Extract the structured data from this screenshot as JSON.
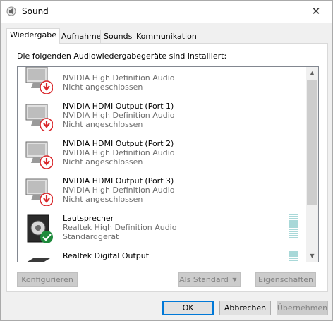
{
  "window": {
    "title": "Sound",
    "close_symbol": "✕"
  },
  "tabs": [
    {
      "label": "Wiedergabe",
      "active": true
    },
    {
      "label": "Aufnahme",
      "active": false
    },
    {
      "label": "Sounds",
      "active": false
    },
    {
      "label": "Kommunikation",
      "active": false
    }
  ],
  "panel": {
    "caption": "Die folgenden Audiowiedergabegeräte sind installiert:"
  },
  "devices": [
    {
      "name": "",
      "driver": "NVIDIA High Definition Audio",
      "status": "Nicht angeschlossen",
      "icon": "monitor-icon",
      "badge": "disconnected-badge-icon"
    },
    {
      "name": "NVIDIA HDMI Output (Port 1)",
      "driver": "NVIDIA High Definition Audio",
      "status": "Nicht angeschlossen",
      "icon": "monitor-icon",
      "badge": "disconnected-badge-icon"
    },
    {
      "name": "NVIDIA HDMI Output (Port 2)",
      "driver": "NVIDIA High Definition Audio",
      "status": "Nicht angeschlossen",
      "icon": "monitor-icon",
      "badge": "disconnected-badge-icon"
    },
    {
      "name": "NVIDIA HDMI Output (Port 3)",
      "driver": "NVIDIA High Definition Audio",
      "status": "Nicht angeschlossen",
      "icon": "monitor-icon",
      "badge": "disconnected-badge-icon"
    },
    {
      "name": "Lautsprecher",
      "driver": "Realtek High Definition Audio",
      "status": "Standardgerät",
      "icon": "speaker-icon",
      "badge": "default-check-badge-icon"
    },
    {
      "name": "Realtek Digital Output",
      "driver": "Realtek High Definition Audio",
      "status": "",
      "icon": "digital-output-icon",
      "badge": ""
    }
  ],
  "buttons": {
    "configure": "Konfigurieren",
    "set_default": "Als Standard",
    "properties": "Eigenschaften",
    "ok": "OK",
    "cancel": "Abbrechen",
    "apply": "Übernehmen"
  },
  "colors": {
    "accent": "#0078d7",
    "disconnected_badge": "#d9262a",
    "default_badge": "#1e8a3c",
    "level_meter": "#a8d8d8"
  }
}
